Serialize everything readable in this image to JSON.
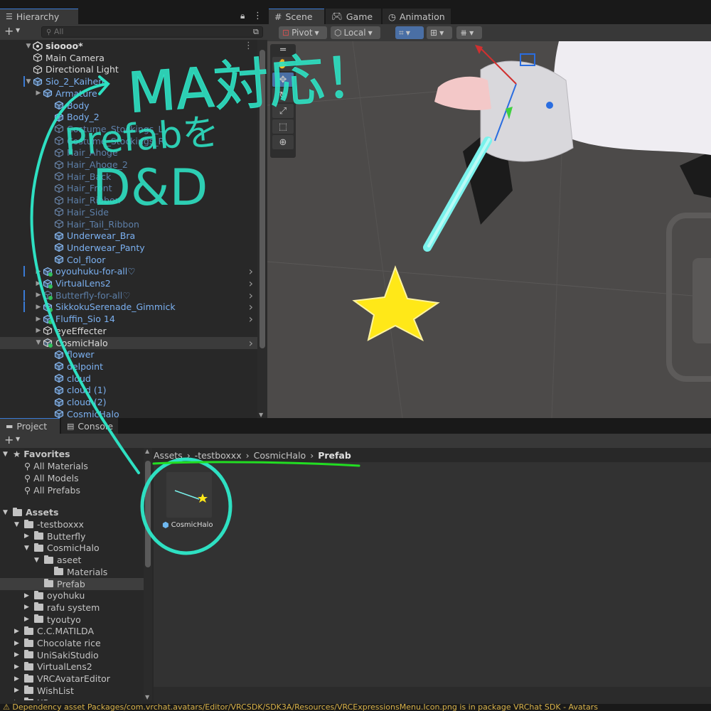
{
  "hierarchy": {
    "tab_label": "Hierarchy",
    "search_placeholder": "All",
    "scene_name": "sioooo*",
    "items": [
      {
        "label": "Main Camera",
        "color": "white"
      },
      {
        "label": "Directional Light",
        "color": "white"
      },
      {
        "label": "Sio_2_Kaihen",
        "color": "blue"
      },
      {
        "label": "Armature",
        "color": "blue"
      },
      {
        "label": "Body",
        "color": "blue"
      },
      {
        "label": "Body_2",
        "color": "blue"
      },
      {
        "label": "Costume_Stockings_L",
        "color": "dim"
      },
      {
        "label": "Costume_Stockings_R",
        "color": "dim"
      },
      {
        "label": "Hair_Ahoge",
        "color": "dim"
      },
      {
        "label": "Hair_Ahoge_2",
        "color": "dim"
      },
      {
        "label": "Hair_Back",
        "color": "dim"
      },
      {
        "label": "Hair_Front",
        "color": "dim"
      },
      {
        "label": "Hair_Ribbon",
        "color": "dim"
      },
      {
        "label": "Hair_Side",
        "color": "dim"
      },
      {
        "label": "Hair_Tail_Ribbon",
        "color": "dim"
      },
      {
        "label": "Underwear_Bra",
        "color": "blue"
      },
      {
        "label": "Underwear_Panty",
        "color": "blue"
      },
      {
        "label": "Col_floor",
        "color": "blue"
      },
      {
        "label": "oyouhuku-for-all♡",
        "color": "blue"
      },
      {
        "label": "VirtualLens2",
        "color": "blue"
      },
      {
        "label": "Butterfly-for-all♡",
        "color": "dim"
      },
      {
        "label": "SikkokuSerenade_Gimmick",
        "color": "blue"
      },
      {
        "label": "Fluffin_Sio 14",
        "color": "blue"
      },
      {
        "label": "eyeEffecter",
        "color": "white"
      },
      {
        "label": "CosmicHalo",
        "color": "white"
      },
      {
        "label": "flower",
        "color": "blue"
      },
      {
        "label": "delpoint",
        "color": "blue"
      },
      {
        "label": "cloud",
        "color": "blue"
      },
      {
        "label": "cloud (1)",
        "color": "blue"
      },
      {
        "label": "cloud (2)",
        "color": "blue"
      },
      {
        "label": "CosmicHalo",
        "color": "blue"
      }
    ]
  },
  "scene": {
    "tabs": [
      "Scene",
      "Game",
      "Animation"
    ],
    "pivot_label": "Pivot",
    "local_label": "Local"
  },
  "project": {
    "tabs": [
      "Project",
      "Console"
    ],
    "favorites_label": "Favorites",
    "favorites": [
      "All Materials",
      "All Models",
      "All Prefabs"
    ],
    "assets_label": "Assets",
    "folders": [
      "-testboxxx",
      "Butterfly",
      "CosmicHalo",
      "aseet",
      "Materials",
      "Prefab",
      "oyohuku",
      "rafu system",
      "tyoutyo",
      "C.C.MATILDA",
      "Chocolate rice",
      "UniSakiStudio",
      "VirtualLens2",
      "VRCAvatarEditor",
      "WishList",
      "XR"
    ],
    "breadcrumb": [
      "Assets",
      "-testboxxx",
      "CosmicHalo",
      "Prefab"
    ],
    "asset_name": "CosmicHalo"
  },
  "status_bar": {
    "message": "Dependency asset Packages/com.vrchat.avatars/Editor/VRCSDK/SDK3A/Resources/VRCExpressionsMenu.Icon.png is in package VRChat SDK - Avatars"
  },
  "annotation": {
    "line1": "MA対応！",
    "line2": "Prefabを",
    "line3": "D&D",
    "color": "#5ee8c8"
  },
  "colors": {
    "accent": "#3a7bd5",
    "annotation_stroke": "#30e0c0",
    "highlight_underline": "#22dd22",
    "star": "#ffe818"
  }
}
